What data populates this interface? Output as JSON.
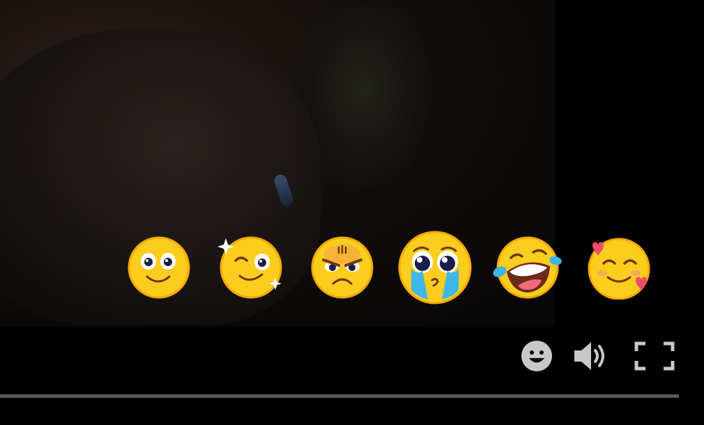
{
  "player": {
    "progress_fraction": 1.0,
    "colors": {
      "background": "#000000",
      "icon_gray": "#c8c8c8",
      "progress_track": "#2a2a2a",
      "emoji_yellow": "#fbcd1e",
      "emoji_outline": "#f5a800"
    }
  },
  "reactions": [
    {
      "name": "smiling-face-icon"
    },
    {
      "name": "winking-sparkle-face-icon"
    },
    {
      "name": "angry-face-icon"
    },
    {
      "name": "pleading-crying-face-icon"
    },
    {
      "name": "tears-of-joy-face-icon"
    },
    {
      "name": "smiling-face-with-hearts-icon"
    }
  ],
  "controls": {
    "icons": [
      "emoji-picker-icon",
      "volume-icon",
      "fullscreen-icon"
    ]
  }
}
